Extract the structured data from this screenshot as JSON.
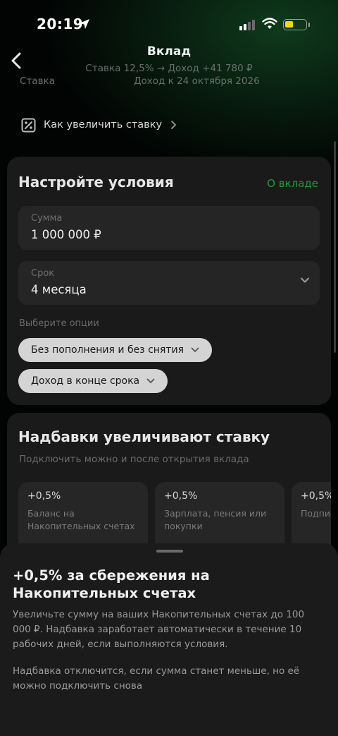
{
  "status_bar": {
    "time": "20:19"
  },
  "header": {
    "title": "Вклад",
    "subtitle": "Ставка 12,5% → Доход +41 780 ₽",
    "rate_label": "Ставка",
    "income_date": "Доход к 24 октября 2026"
  },
  "increase_rate_link": "Как увеличить ставку",
  "conditions": {
    "title": "Настройте условия",
    "about_link": "О вкладе",
    "amount": {
      "label": "Сумма",
      "value": "1 000 000 ₽"
    },
    "term": {
      "label": "Срок",
      "value": "4 месяца"
    },
    "options_label": "Выберите опции",
    "options": [
      "Без пополнения и без снятия",
      "Доход в конце срока"
    ]
  },
  "bonuses": {
    "title": "Надбавки увеличивают ставку",
    "subtitle": "Подключить можно и после открытия вклада",
    "items": [
      {
        "value": "+0,5%",
        "description": "Баланс на Накопительных счетах"
      },
      {
        "value": "+0,5%",
        "description": "Зарплата, пенсия или покупки"
      },
      {
        "value": "+0,5%",
        "description": "Подпис"
      }
    ]
  },
  "sheet": {
    "title": "+0,5% за сбережения на Накопительных счетах",
    "body": "Увеличьте сумму на ваших Накопительных счетах до 100 000 ₽. Надбавка заработает автоматически в течение 10 рабочих дней, если выполняются условия.",
    "body2": "Надбавка отключится, если сумма станет меньше, но её можно подключить снова"
  },
  "colors": {
    "accent": "#1f9a3a",
    "background": "#020302",
    "card": "#1a1a1a"
  }
}
